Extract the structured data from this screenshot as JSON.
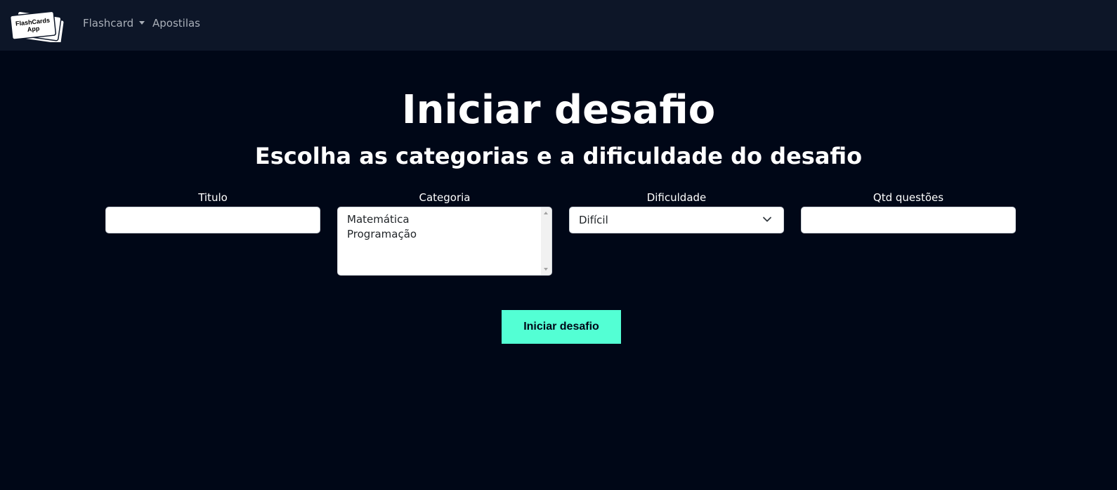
{
  "navbar": {
    "logo_text_line1": "FlashCards",
    "logo_text_line2": "App",
    "menu": [
      {
        "label": "Flashcard",
        "has_dropdown": true
      },
      {
        "label": "Apostilas",
        "has_dropdown": false
      }
    ]
  },
  "page": {
    "title": "Iniciar desafio",
    "subtitle": "Escolha as categorias e a dificuldade do desafio"
  },
  "form": {
    "titulo": {
      "label": "Titulo",
      "value": ""
    },
    "categoria": {
      "label": "Categoria",
      "options": [
        "Matemática",
        "Programação"
      ]
    },
    "dificuldade": {
      "label": "Dificuldade",
      "value": "Difícil"
    },
    "qtd": {
      "label": "Qtd questões",
      "value": ""
    },
    "submit_label": "Iniciar desafio"
  },
  "colors": {
    "background": "#000717",
    "navbar": "#0d1628",
    "accent": "#53ffd4"
  }
}
